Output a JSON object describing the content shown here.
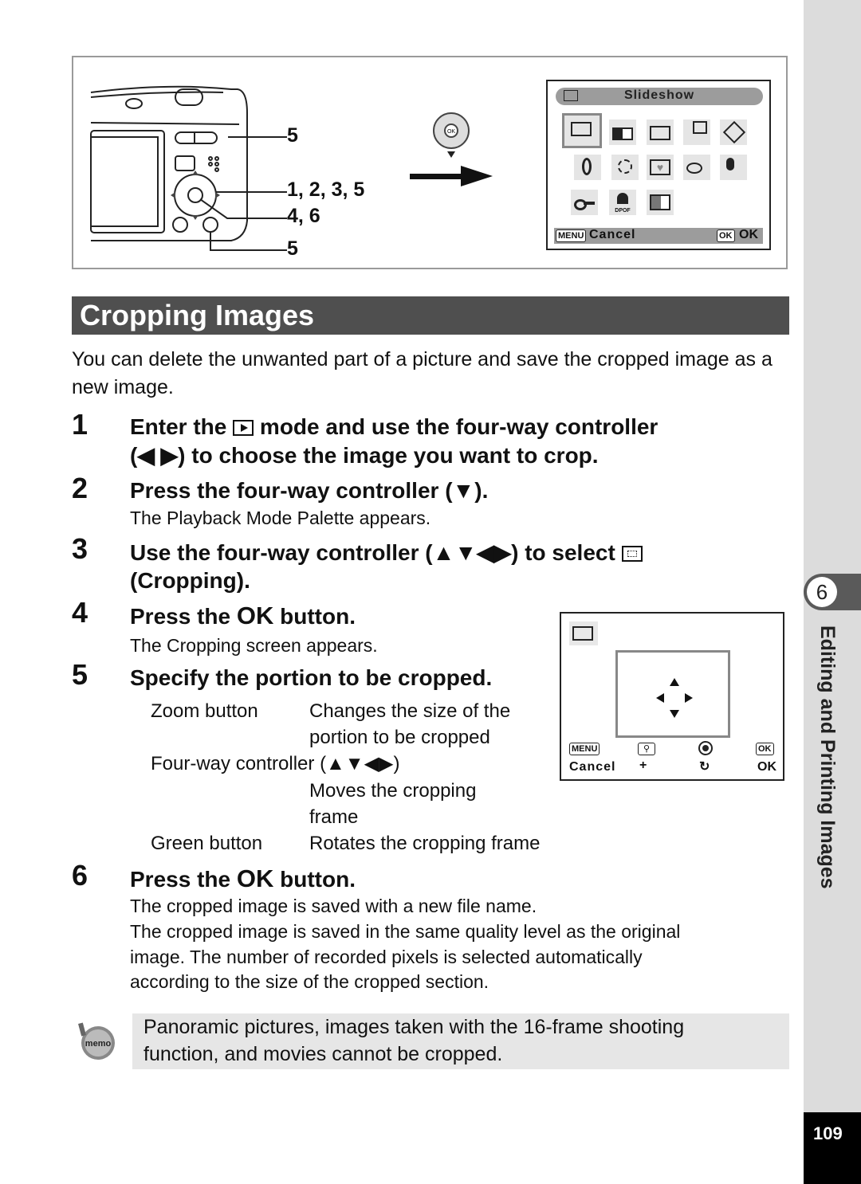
{
  "figure_top": {
    "callouts": [
      "5",
      "1, 2, 3, 5",
      "4, 6",
      "5"
    ],
    "palette_screen": {
      "title": "Slideshow",
      "icons_row1": [
        "slideshow-icon",
        "resize-icon",
        "cropping-icon",
        "image-copy-icon",
        "rotate-icon"
      ],
      "icons_row2": [
        "digital-filter-icon",
        "brightness-filter-icon",
        "frame-composite-icon",
        "red-eye-edit-icon",
        "voice-memo-icon"
      ],
      "icons_row3": [
        "protect-icon",
        "dpof-icon",
        "startup-screen-icon"
      ],
      "dpof_label": "DPOF",
      "menu_label": "MENU",
      "cancel_label": "Cancel",
      "ok_btn_label": "OK",
      "ok_label": "OK"
    }
  },
  "section": {
    "title": "Cropping Images",
    "intro": "You can delete the unwanted part of a picture and save the cropped image as a new image."
  },
  "steps": [
    {
      "num": "1",
      "line1_pre": "Enter the",
      "line1_post": "mode and use the four-way controller",
      "line2": "(◀ ▶) to choose the image you want to crop."
    },
    {
      "num": "2",
      "head": "Press the four-way controller (▼).",
      "body": "The Playback Mode Palette appears."
    },
    {
      "num": "3",
      "line1_pre": "Use the four-way controller (▲▼◀▶) to select",
      "line2": "(Cropping)."
    },
    {
      "num": "4",
      "head_pre": "Press the",
      "head_ok": "OK",
      "head_post": "button.",
      "body": "The Cropping screen appears."
    },
    {
      "num": "5",
      "head": "Specify the portion to be cropped."
    },
    {
      "num": "6",
      "head_pre": "Press the",
      "head_ok": "OK",
      "head_post": "button.",
      "body": [
        "The cropped image is saved with a new file name.",
        "The cropped image is saved in the same quality level as the original",
        "image. The number of recorded pixels is selected automatically",
        "according to the size of the cropped section."
      ]
    }
  ],
  "controls_table": [
    {
      "control": "Zoom button",
      "desc": [
        "Changes the size of the",
        "portion to be cropped"
      ]
    },
    {
      "control": "Four-way controller (▲▼◀▶)",
      "desc": [
        "Moves the cropping",
        "frame"
      ]
    },
    {
      "control": "Green button",
      "desc": [
        "Rotates the cropping frame"
      ]
    }
  ],
  "crop_screen": {
    "menu_label": "MENU",
    "cancel_label": "Cancel",
    "ok_btn_label": "OK",
    "ok_label": "OK"
  },
  "memo": {
    "icon_label": "memo",
    "text_line1": "Panoramic pictures, images taken with the 16-frame shooting",
    "text_line2": "function, and movies cannot be cropped."
  },
  "side_tab": {
    "chapter_number": "6",
    "chapter_title": "Editing and Printing Images"
  },
  "page_number": "109"
}
